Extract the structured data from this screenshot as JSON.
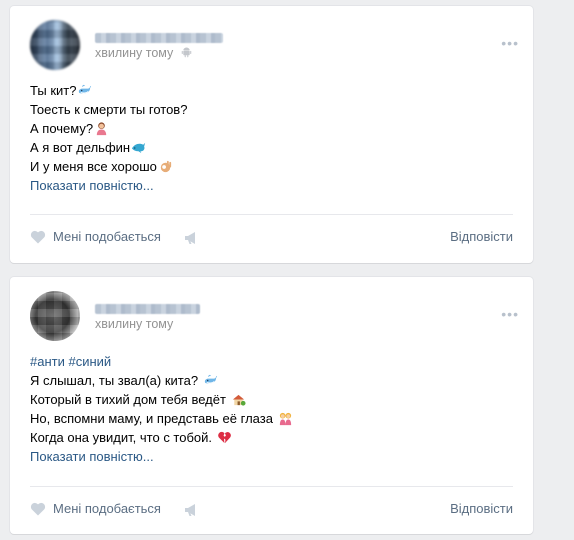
{
  "posts": [
    {
      "time": "хвилину тому",
      "lines": [
        "Ты кит?",
        "Тоесть к смерти ты готов?",
        "А почему?",
        "А я вот дельфин",
        "И у меня все хорошо"
      ],
      "show_more": "Показати повністю...",
      "like_label": "Мені подобається",
      "reply_label": "Відповісти"
    },
    {
      "time": "хвилину тому",
      "hashtags": "#анти #синий",
      "lines": [
        "Я слышал, ты звал(а) кита?",
        "Который в тихий дом тебя ведёт",
        "Но, вспомни маму, и представь её глаза",
        "Когда она увидит, что с тобой."
      ],
      "show_more": "Показати повністю...",
      "like_label": "Мені подобається",
      "reply_label": "Відповісти"
    }
  ],
  "icons": {
    "more": "ellipsis-icon",
    "like": "heart-icon",
    "share": "megaphone-icon",
    "platform": "android-icon"
  },
  "colors": {
    "link": "#2a5885",
    "muted": "#939393",
    "action": "#5b6e83",
    "background": "#edeef0"
  }
}
